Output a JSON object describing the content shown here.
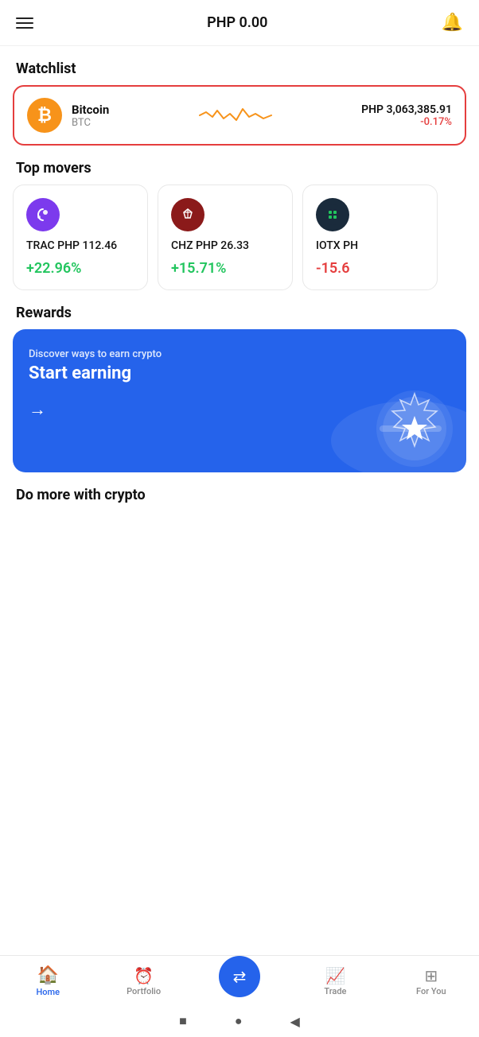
{
  "header": {
    "balance": "PHP 0.00",
    "menu_label": "menu",
    "bell_label": "notifications"
  },
  "watchlist": {
    "section_title": "Watchlist",
    "item": {
      "name": "Bitcoin",
      "symbol": "BTC",
      "price": "PHP 3,063,385.91",
      "change": "-0.17%",
      "change_positive": false
    }
  },
  "top_movers": {
    "section_title": "Top movers",
    "items": [
      {
        "symbol": "TRAC",
        "price": "PHP 112.46",
        "change": "+22.96%",
        "positive": true,
        "icon_color": "#7c3aed"
      },
      {
        "symbol": "CHZ",
        "price": "PHP 26.33",
        "change": "+15.71%",
        "positive": true,
        "icon_color": "#8b1a1a"
      },
      {
        "symbol": "IOTX",
        "price": "PH",
        "change": "-15.6",
        "positive": false,
        "icon_color": "#1a2b3c"
      }
    ]
  },
  "rewards": {
    "section_title": "Rewards",
    "subtitle": "Discover ways to earn crypto",
    "title": "Start earning",
    "arrow": "→"
  },
  "do_more": {
    "section_title": "Do more with crypto"
  },
  "bottom_nav": {
    "items": [
      {
        "label": "Home",
        "icon": "🏠",
        "active": true
      },
      {
        "label": "Portfolio",
        "icon": "🕐",
        "active": false
      },
      {
        "label": "",
        "icon": "⇄",
        "active": false,
        "center": true
      },
      {
        "label": "Trade",
        "icon": "📈",
        "active": false
      },
      {
        "label": "For You",
        "icon": "⊞",
        "active": false
      }
    ]
  },
  "system_nav": {
    "square": "■",
    "circle": "●",
    "back": "◀"
  }
}
